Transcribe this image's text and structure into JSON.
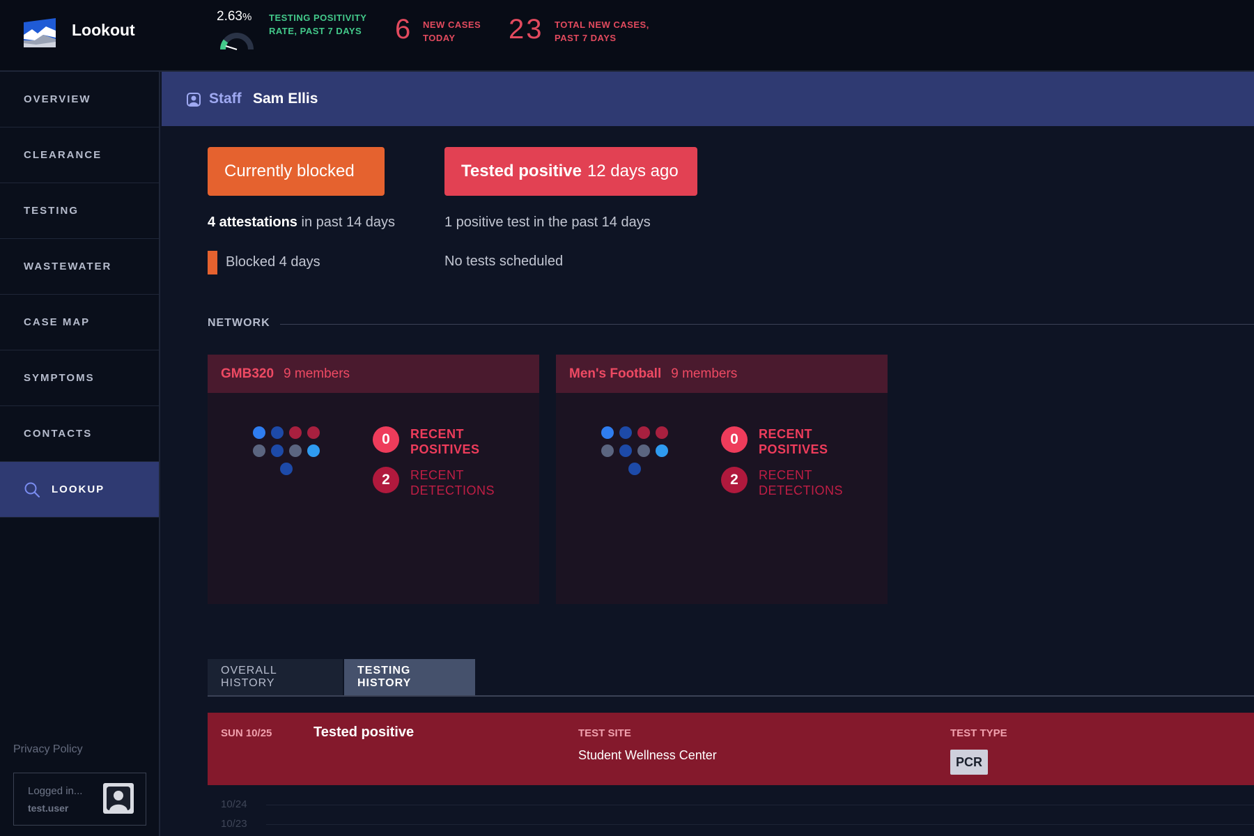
{
  "app": {
    "name": "Lookout"
  },
  "header": {
    "positivity_rate": "2.63",
    "positivity_unit": "%",
    "positivity_label": "TESTING POSITIVITY RATE, PAST 7 DAYS",
    "new_cases_today": "6",
    "new_cases_label": "NEW CASES TODAY",
    "total_new_cases": "23",
    "total_new_cases_label": "TOTAL NEW CASES, PAST 7 DAYS"
  },
  "sidebar": {
    "items": [
      {
        "label": "OVERVIEW"
      },
      {
        "label": "CLEARANCE"
      },
      {
        "label": "TESTING"
      },
      {
        "label": "WASTEWATER"
      },
      {
        "label": "CASE MAP"
      },
      {
        "label": "SYMPTOMS"
      },
      {
        "label": "CONTACTS"
      },
      {
        "label": "LOOKUP",
        "active": true,
        "icon": "search-icon"
      }
    ],
    "privacy_label": "Privacy Policy",
    "login_status": "Logged in...",
    "login_user": "test.user"
  },
  "person": {
    "role": "Staff",
    "name": "Sam Ellis"
  },
  "status": {
    "blocked_label": "Currently blocked",
    "positive_bold": "Tested positive",
    "positive_rest": "12 days ago",
    "attestations_bold": "4 attestations",
    "attestations_rest": "in past 14 days",
    "blocked_days": "Blocked 4 days",
    "positive_tests": "1 positive test in the past 14 days",
    "scheduled": "No tests scheduled"
  },
  "network": {
    "label": "NETWORK",
    "groups": [
      {
        "name": "GMB320",
        "members": "9 members",
        "recent_positives": "0",
        "positives_label": "RECENT POSITIVES",
        "recent_detections": "2",
        "detections_label": "RECENT DETECTIONS"
      },
      {
        "name": "Men's Football",
        "members": "9 members",
        "recent_positives": "0",
        "positives_label": "RECENT POSITIVES",
        "recent_detections": "2",
        "detections_label": "RECENT DETECTIONS"
      }
    ],
    "dot_colors": [
      "#2f7df0",
      "#1d4aa8",
      "#a8203f",
      "#a8203f",
      "#5b6580",
      "#1d4aa8",
      "#5b6580",
      "#2f9bf0",
      "#1d4aa8"
    ]
  },
  "tabs": {
    "overall": "OVERALL HISTORY",
    "testing": "TESTING HISTORY"
  },
  "history": {
    "date": "SUN 10/25",
    "title": "Tested positive",
    "site_label": "TEST SITE",
    "site": "Student Wellness Center",
    "type_label": "TEST TYPE",
    "type": "PCR",
    "timeline": [
      "10/24",
      "10/23"
    ]
  },
  "colors": {
    "accent": "#2f3a72",
    "blocked": "#e5622f",
    "positive": "#e24153",
    "success": "#43c98a"
  }
}
